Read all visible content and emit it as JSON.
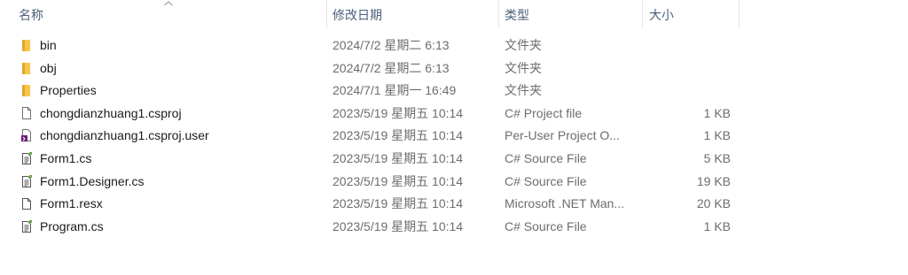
{
  "columns": {
    "name": "名称",
    "modified": "修改日期",
    "type": "类型",
    "size": "大小"
  },
  "sort": {
    "column": "name",
    "direction": "ascending"
  },
  "files": [
    {
      "name": "bin",
      "modified": "2024/7/2 星期二 6:13",
      "type": "文件夹",
      "size": "",
      "icon": "folder-icon"
    },
    {
      "name": "obj",
      "modified": "2024/7/2 星期二 6:13",
      "type": "文件夹",
      "size": "",
      "icon": "folder-icon"
    },
    {
      "name": "Properties",
      "modified": "2024/7/1 星期一 16:49",
      "type": "文件夹",
      "size": "",
      "icon": "folder-icon"
    },
    {
      "name": "chongdianzhuang1.csproj",
      "modified": "2023/5/19 星期五 10:14",
      "type": "C# Project file",
      "size": "1 KB",
      "icon": "blank-file-icon"
    },
    {
      "name": "chongdianzhuang1.csproj.user",
      "modified": "2023/5/19 星期五 10:14",
      "type": "Per-User Project O...",
      "size": "1 KB",
      "icon": "visual-studio-file-icon"
    },
    {
      "name": "Form1.cs",
      "modified": "2023/5/19 星期五 10:14",
      "type": "C# Source File",
      "size": "5 KB",
      "icon": "source-file-icon"
    },
    {
      "name": "Form1.Designer.cs",
      "modified": "2023/5/19 星期五 10:14",
      "type": "C# Source File",
      "size": "19 KB",
      "icon": "source-file-icon"
    },
    {
      "name": "Form1.resx",
      "modified": "2023/5/19 星期五 10:14",
      "type": "Microsoft .NET Man...",
      "size": "20 KB",
      "icon": "resource-file-icon"
    },
    {
      "name": "Program.cs",
      "modified": "2023/5/19 星期五 10:14",
      "type": "C# Source File",
      "size": "1 KB",
      "icon": "source-file-icon"
    }
  ],
  "colors": {
    "folder": "#f8c647",
    "header_text": "#4c607a",
    "secondary_text": "#6d6d6d"
  }
}
